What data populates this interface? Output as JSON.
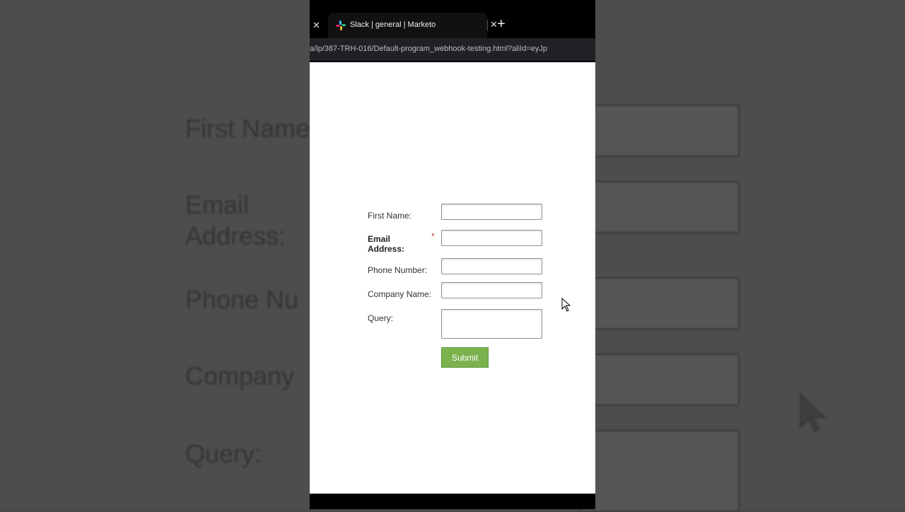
{
  "background_echo": {
    "labels": [
      "First Name",
      "Email",
      "Address:",
      "Phone Nu",
      "Company",
      "Query:"
    ]
  },
  "browser": {
    "tab": {
      "title": "Slack | general | Marketo",
      "icon": "slack-icon"
    },
    "url": "a/lp/387-TRH-016/Default-program_webhook-testing.html?aliId=eyJp"
  },
  "form": {
    "fields": [
      {
        "label": "First Name:",
        "required": false
      },
      {
        "label": "Email Address:",
        "required": true,
        "required_mark": "*"
      },
      {
        "label": "Phone Number:",
        "required": false
      },
      {
        "label": "Company Name:",
        "required": false
      },
      {
        "label": "Query:",
        "required": false
      }
    ],
    "submit_label": "Submit"
  },
  "colors": {
    "submit_green": "#7bb24e",
    "required_red": "#c0392b"
  }
}
